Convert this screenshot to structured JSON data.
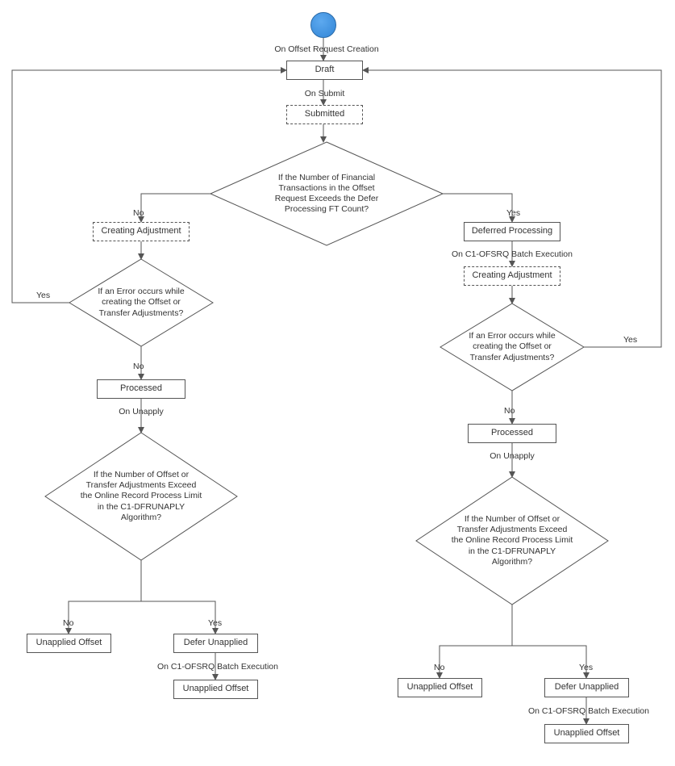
{
  "chart_data": {
    "type": "flowchart",
    "start": "Start",
    "nodes": {
      "on_creation": "On Offset Request Creation",
      "draft": "Draft",
      "on_submit": "On Submit",
      "submitted": "Submitted",
      "d1": "If the Number of Financial Transactions in the Offset Request Exceeds the Defer Processing FT Count?",
      "creating_adj_left": "Creating Adjustment",
      "d2": "If an Error occurs while creating the Offset or Transfer Adjustments?",
      "processed_left": "Processed",
      "on_unapply_left": "On Unapply",
      "d3": "If the Number of Offset or Transfer Adjustments Exceed the Online Record Process Limit in the C1-DFRUNAPLY Algorithm?",
      "unapplied_left_no": "Unapplied Offset",
      "defer_unapplied_left": "Defer Unapplied",
      "on_batch_left2": "On C1-OFSRQ Batch Execution",
      "unapplied_left_yes": "Unapplied Offset",
      "deferred_processing": "Deferred Processing",
      "on_batch_right1": "On C1-OFSRQ Batch Execution",
      "creating_adj_right": "Creating Adjustment",
      "d4": "If an Error occurs while creating the Offset or Transfer Adjustments?",
      "processed_right": "Processed",
      "on_unapply_right": "On Unapply",
      "d5": "If the Number of Offset or Transfer Adjustments Exceed the Online Record Process Limit in the C1-DFRUNAPLY Algorithm?",
      "unapplied_right_no": "Unapplied Offset",
      "defer_unapplied_right": "Defer Unapplied",
      "on_batch_right2": "On C1-OFSRQ Batch Execution",
      "unapplied_right_yes": "Unapplied Offset"
    },
    "edge_labels": {
      "d1_no": "No",
      "d1_yes": "Yes",
      "d2_yes": "Yes",
      "d2_no": "No",
      "d3_no": "No",
      "d3_yes": "Yes",
      "d4_yes": "Yes",
      "d4_no": "No",
      "d5_no": "No",
      "d5_yes": "Yes"
    },
    "edges": [
      [
        "start",
        "on_creation"
      ],
      [
        "on_creation",
        "draft"
      ],
      [
        "draft",
        "on_submit"
      ],
      [
        "on_submit",
        "submitted"
      ],
      [
        "submitted",
        "d1"
      ],
      [
        "d1",
        "creating_adj_left",
        "No"
      ],
      [
        "creating_adj_left",
        "d2"
      ],
      [
        "d2",
        "draft",
        "Yes"
      ],
      [
        "d2",
        "processed_left",
        "No"
      ],
      [
        "processed_left",
        "on_unapply_left"
      ],
      [
        "on_unapply_left",
        "d3"
      ],
      [
        "d3",
        "unapplied_left_no",
        "No"
      ],
      [
        "d3",
        "defer_unapplied_left",
        "Yes"
      ],
      [
        "defer_unapplied_left",
        "on_batch_left2"
      ],
      [
        "on_batch_left2",
        "unapplied_left_yes"
      ],
      [
        "d1",
        "deferred_processing",
        "Yes"
      ],
      [
        "deferred_processing",
        "on_batch_right1"
      ],
      [
        "on_batch_right1",
        "creating_adj_right"
      ],
      [
        "creating_adj_right",
        "d4"
      ],
      [
        "d4",
        "draft",
        "Yes"
      ],
      [
        "d4",
        "processed_right",
        "No"
      ],
      [
        "processed_right",
        "on_unapply_right"
      ],
      [
        "on_unapply_right",
        "d5"
      ],
      [
        "d5",
        "unapplied_right_no",
        "No"
      ],
      [
        "d5",
        "defer_unapplied_right",
        "Yes"
      ],
      [
        "defer_unapplied_right",
        "on_batch_right2"
      ],
      [
        "on_batch_right2",
        "unapplied_right_yes"
      ]
    ]
  }
}
